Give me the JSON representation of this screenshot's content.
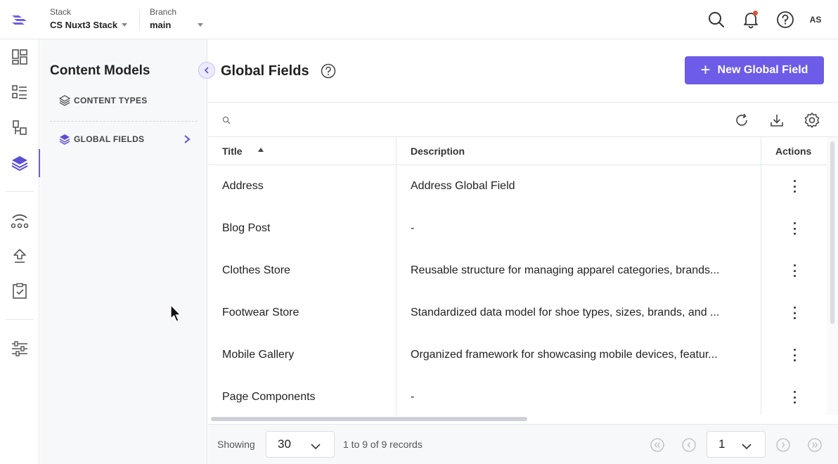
{
  "header": {
    "stack_label": "Stack",
    "stack_value": "CS Nuxt3 Stack",
    "branch_label": "Branch",
    "branch_value": "main",
    "user_initials": "AS",
    "icons": [
      "search-icon",
      "bell-icon",
      "help-icon"
    ]
  },
  "rail": {
    "items": [
      "dashboard-icon",
      "entries-icon",
      "content-models-icon",
      "stack-layers-icon",
      "network-icon",
      "deploy-icon",
      "tasks-icon",
      "settings-sliders-icon"
    ],
    "active": "stack-layers-icon"
  },
  "panel": {
    "title": "Content Models",
    "items": [
      {
        "label": "CONTENT TYPES",
        "icon": "layers-icon"
      },
      {
        "label": "GLOBAL FIELDS",
        "icon": "layers-filled-icon"
      }
    ]
  },
  "main": {
    "title": "Global Fields",
    "new_button_label": "New Global Field"
  },
  "table": {
    "columns": [
      "Title",
      "Description",
      "Actions"
    ],
    "rows": [
      {
        "title": "Address",
        "description": "Address Global Field"
      },
      {
        "title": "Blog Post",
        "description": "-"
      },
      {
        "title": "Clothes Store",
        "description": "Reusable structure for managing apparel categories, brands..."
      },
      {
        "title": "Footwear Store",
        "description": "Standardized data model for shoe types, sizes, brands, and ..."
      },
      {
        "title": "Mobile Gallery",
        "description": "Organized framework for showcasing mobile devices, featur..."
      },
      {
        "title": "Page Components",
        "description": "-"
      }
    ]
  },
  "footer": {
    "showing_label": "Showing",
    "page_size": "30",
    "records_text": "1 to 9 of 9 records",
    "current_page": "1"
  },
  "colors": {
    "accent": "#6c5ce7",
    "border": "#e5e6ea",
    "panel_bg": "#f7f8fa"
  }
}
